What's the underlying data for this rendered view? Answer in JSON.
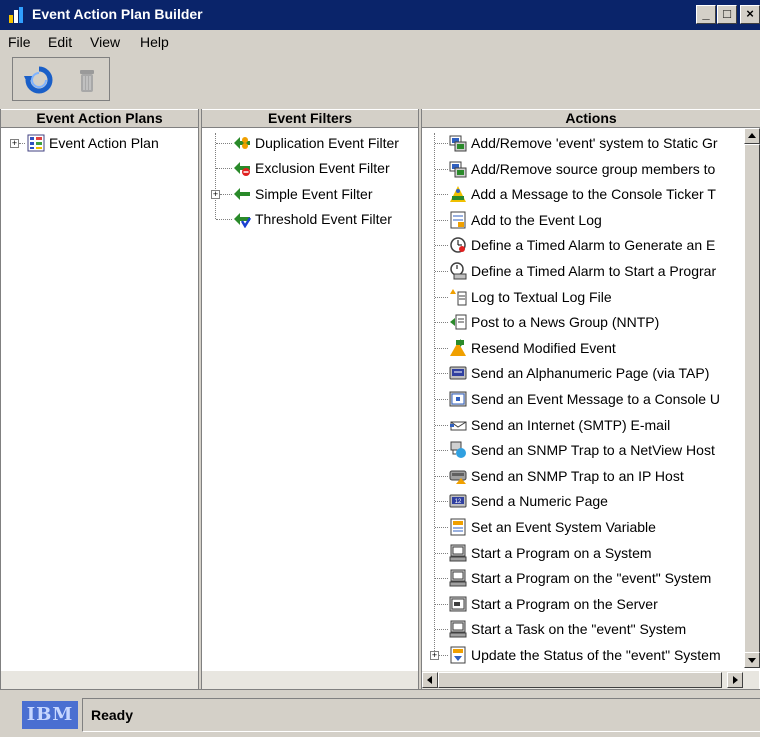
{
  "window": {
    "title": "Event Action Plan Builder",
    "buttons": {
      "minimize": "_",
      "maximize": "□",
      "close": "×"
    }
  },
  "menu": {
    "items": [
      "File",
      "Edit",
      "View",
      "Help"
    ]
  },
  "toolbar": {
    "icons": [
      "refresh-icon",
      "trash-icon"
    ]
  },
  "panes": {
    "plans": {
      "header": "Event Action Plans",
      "items": [
        {
          "label": "Event Action Plan",
          "expandable": true,
          "icon": "plan-icon"
        }
      ]
    },
    "filters": {
      "header": "Event Filters",
      "items": [
        {
          "label": "Duplication Event Filter",
          "expandable": false,
          "icon": "duplication-filter-icon"
        },
        {
          "label": "Exclusion Event Filter",
          "expandable": false,
          "icon": "exclusion-filter-icon"
        },
        {
          "label": "Simple Event Filter",
          "expandable": true,
          "icon": "simple-filter-icon"
        },
        {
          "label": "Threshold Event Filter",
          "expandable": false,
          "icon": "threshold-filter-icon"
        }
      ]
    },
    "actions": {
      "header": "Actions",
      "items": [
        {
          "label": "Add/Remove 'event' system to Static Gr",
          "icon": "group-icon"
        },
        {
          "label": "Add/Remove source group members to",
          "icon": "group-icon"
        },
        {
          "label": "Add a Message to the Console Ticker T",
          "icon": "ticker-icon"
        },
        {
          "label": "Add to the Event Log",
          "icon": "log-icon"
        },
        {
          "label": "Define a Timed Alarm to Generate an E",
          "icon": "alarm-icon"
        },
        {
          "label": "Define a Timed Alarm to Start a Prograr",
          "icon": "alarm-program-icon"
        },
        {
          "label": "Log to Textual Log File",
          "icon": "text-log-icon"
        },
        {
          "label": "Post to a News Group (NNTP)",
          "icon": "news-icon"
        },
        {
          "label": "Resend Modified Event",
          "icon": "resend-icon"
        },
        {
          "label": "Send an Alphanumeric Page (via TAP)",
          "icon": "pager-icon"
        },
        {
          "label": "Send an Event Message to a Console U",
          "icon": "console-icon"
        },
        {
          "label": "Send an Internet (SMTP) E-mail",
          "icon": "email-icon"
        },
        {
          "label": "Send an SNMP Trap to a NetView Host",
          "icon": "snmp-netview-icon"
        },
        {
          "label": "Send an SNMP Trap to an IP Host",
          "icon": "snmp-ip-icon"
        },
        {
          "label": "Send a Numeric Page",
          "icon": "numeric-pager-icon"
        },
        {
          "label": "Set an Event System Variable",
          "icon": "variable-icon"
        },
        {
          "label": "Start a Program on a System",
          "icon": "computer-icon"
        },
        {
          "label": "Start a Program on the \"event\" System",
          "icon": "computer-icon"
        },
        {
          "label": "Start a Program on the Server",
          "icon": "server-icon"
        },
        {
          "label": "Start a Task on the \"event\" System",
          "icon": "computer-icon"
        },
        {
          "label": "Update the Status of the \"event\" System",
          "icon": "status-icon",
          "expandable": true
        }
      ]
    }
  },
  "status": {
    "brand": "IBM",
    "text": "Ready"
  }
}
